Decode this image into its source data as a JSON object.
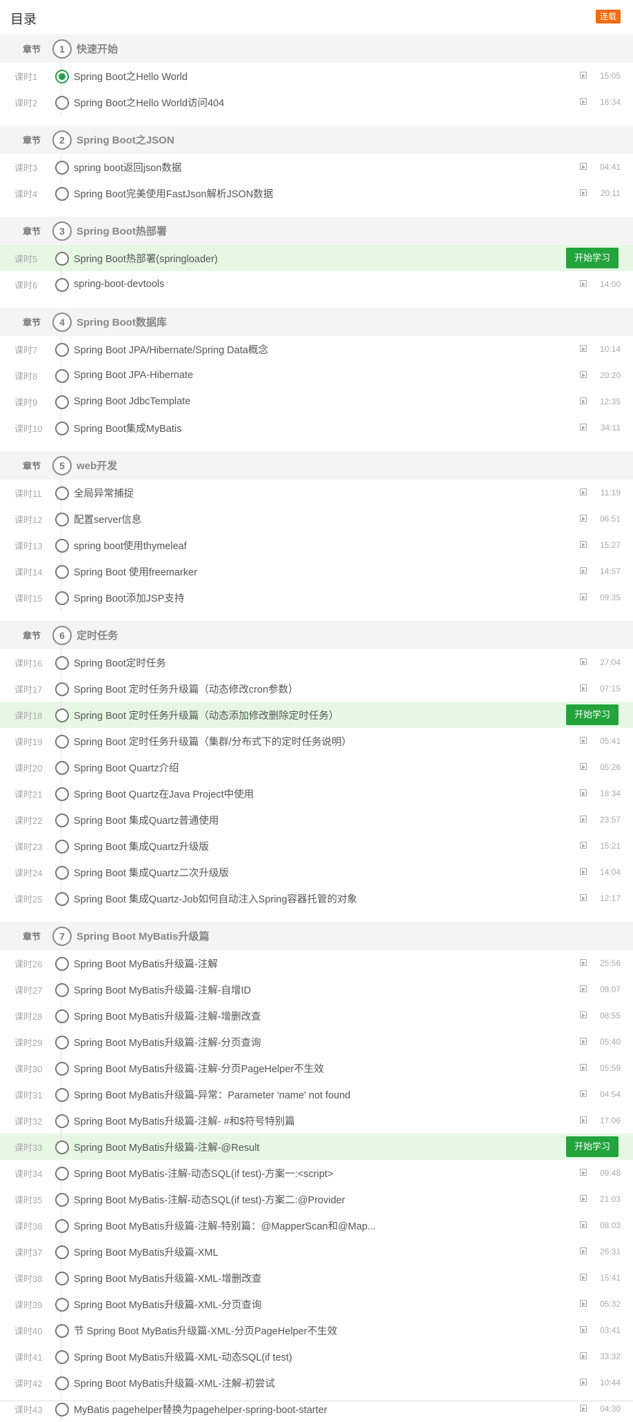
{
  "header": {
    "title": "目录",
    "badge": "连载"
  },
  "chapter_label": "章节",
  "start_label": "开始学习",
  "chapters": [
    {
      "num": "1",
      "title": "快速开始",
      "lessons": [
        {
          "label": "课时1",
          "title": "Spring Boot之Hello World",
          "time": "15:05",
          "done": true
        },
        {
          "label": "课时2",
          "title": "Spring Boot之Hello World访问404",
          "time": "16:34"
        }
      ]
    },
    {
      "num": "2",
      "title": "Spring Boot之JSON",
      "lessons": [
        {
          "label": "课时3",
          "title": "spring boot返回json数据",
          "time": "04:41"
        },
        {
          "label": "课时4",
          "title": "Spring Boot完美使用FastJson解析JSON数据",
          "time": "20:11"
        }
      ]
    },
    {
      "num": "3",
      "title": "Spring Boot热部署",
      "lessons": [
        {
          "label": "课时5",
          "title": "Spring Boot热部署(springloader)",
          "time": "",
          "active": true
        },
        {
          "label": "课时6",
          "title": "spring-boot-devtools",
          "time": "14:00"
        }
      ]
    },
    {
      "num": "4",
      "title": "Spring Boot数据库",
      "lessons": [
        {
          "label": "课时7",
          "title": "Spring Boot JPA/Hibernate/Spring Data概念",
          "time": "10:14"
        },
        {
          "label": "课时8",
          "title": "Spring Boot JPA-Hibernate",
          "time": "20:20"
        },
        {
          "label": "课时9",
          "title": "Spring Boot JdbcTemplate",
          "time": "12:35"
        },
        {
          "label": "课时10",
          "title": "Spring Boot集成MyBatis",
          "time": "34:11"
        }
      ]
    },
    {
      "num": "5",
      "title": "web开发",
      "lessons": [
        {
          "label": "课时11",
          "title": "全局异常捕捉",
          "time": "11:19"
        },
        {
          "label": "课时12",
          "title": "配置server信息",
          "time": "06:51"
        },
        {
          "label": "课时13",
          "title": "spring boot使用thymeleaf",
          "time": "15:27"
        },
        {
          "label": "课时14",
          "title": "Spring Boot 使用freemarker",
          "time": "14:57"
        },
        {
          "label": "课时15",
          "title": "Spring Boot添加JSP支持",
          "time": "09:35"
        }
      ]
    },
    {
      "num": "6",
      "title": "定时任务",
      "lessons": [
        {
          "label": "课时16",
          "title": "Spring Boot定时任务",
          "time": "27:04"
        },
        {
          "label": "课时17",
          "title": "Spring Boot 定时任务升级篇（动态修改cron参数）",
          "time": "07:15"
        },
        {
          "label": "课时18",
          "title": "Spring Boot 定时任务升级篇（动态添加修改删除定时任务）",
          "time": "",
          "active": true
        },
        {
          "label": "课时19",
          "title": "Spring Boot 定时任务升级篇（集群/分布式下的定时任务说明）",
          "time": "05:41"
        },
        {
          "label": "课时20",
          "title": "Spring Boot Quartz介绍",
          "time": "05:26"
        },
        {
          "label": "课时21",
          "title": "Spring Boot Quartz在Java Project中使用",
          "time": "18:34"
        },
        {
          "label": "课时22",
          "title": "Spring Boot 集成Quartz普通使用",
          "time": "23:57"
        },
        {
          "label": "课时23",
          "title": "Spring Boot 集成Quartz升级版",
          "time": "15:21"
        },
        {
          "label": "课时24",
          "title": "Spring Boot 集成Quartz二次升级版",
          "time": "14:04"
        },
        {
          "label": "课时25",
          "title": "Spring Boot 集成Quartz-Job如何自动注入Spring容器托管的对象",
          "time": "12:17"
        }
      ]
    },
    {
      "num": "7",
      "title": "Spring Boot MyBatis升级篇",
      "lessons": [
        {
          "label": "课时26",
          "title": "Spring Boot MyBatis升级篇-注解",
          "time": "25:56"
        },
        {
          "label": "课时27",
          "title": "Spring Boot MyBatis升级篇-注解-自增ID",
          "time": "08:07"
        },
        {
          "label": "课时28",
          "title": "Spring Boot MyBatis升级篇-注解-增删改查",
          "time": "08:55"
        },
        {
          "label": "课时29",
          "title": "Spring Boot MyBatis升级篇-注解-分页查询",
          "time": "05:40"
        },
        {
          "label": "课时30",
          "title": "Spring Boot MyBatis升级篇-注解-分页PageHelper不生效",
          "time": "05:59"
        },
        {
          "label": "课时31",
          "title": "Spring Boot MyBatis升级篇-异常：Parameter 'name' not found",
          "time": "04:54"
        },
        {
          "label": "课时32",
          "title": "Spring Boot MyBatis升级篇-注解- #和$符号特别篇",
          "time": "17:06"
        },
        {
          "label": "课时33",
          "title": "Spring Boot MyBatis升级篇-注解-@Result",
          "time": "",
          "active": true
        },
        {
          "label": "课时34",
          "title": "Spring Boot MyBatis-注解-动态SQL(if test)-方案一:<script>",
          "time": "09:48"
        },
        {
          "label": "课时35",
          "title": "Spring Boot MyBatis-注解-动态SQL(if test)-方案二:@Provider",
          "time": "21:03"
        },
        {
          "label": "课时36",
          "title": "Spring Boot MyBatis升级篇-注解-特别篇：@MapperScan和@Map...",
          "time": "08:03"
        },
        {
          "label": "课时37",
          "title": "Spring Boot MyBatis升级篇-XML",
          "time": "26:31"
        },
        {
          "label": "课时38",
          "title": " Spring Boot MyBatis升级篇-XML-增删改查",
          "time": "15:41"
        },
        {
          "label": "课时39",
          "title": "Spring Boot MyBatis升级篇-XML-分页查询",
          "time": "05:32"
        },
        {
          "label": "课时40",
          "title": "节 Spring Boot MyBatis升级篇-XML-分页PageHelper不生效",
          "time": "03:41"
        },
        {
          "label": "课时41",
          "title": "Spring Boot MyBatis升级篇-XML-动态SQL(if test)",
          "time": "33:32"
        },
        {
          "label": "课时42",
          "title": "Spring Boot MyBatis升级篇-XML-注解-初尝试",
          "time": "10:44"
        },
        {
          "label": "课时43",
          "title": " MyBatis pagehelper替换为pagehelper-spring-boot-starter",
          "time": "04:30"
        }
      ]
    }
  ]
}
